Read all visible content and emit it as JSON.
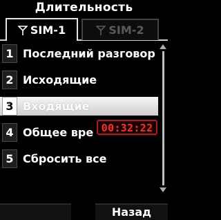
{
  "header": {
    "title": "Длительность"
  },
  "tabs": [
    {
      "label": "SIM-1",
      "active": true
    },
    {
      "label": "SIM-2",
      "active": false
    }
  ],
  "menu": {
    "items": [
      {
        "number": "1",
        "label": "Последний разговор"
      },
      {
        "number": "2",
        "label": "Исходящие"
      },
      {
        "number": "3",
        "label": "Входящие"
      },
      {
        "number": "4",
        "label": "Общее вре"
      },
      {
        "number": "5",
        "label": "Сбросить все"
      }
    ],
    "selected_index": 2
  },
  "timer": {
    "value": "00:32:22"
  },
  "softkeys": {
    "left": "",
    "right": "Назад"
  },
  "colors": {
    "background": "#000000",
    "timer": "#ff2a2a",
    "selected_row": "#e6e6e6"
  }
}
